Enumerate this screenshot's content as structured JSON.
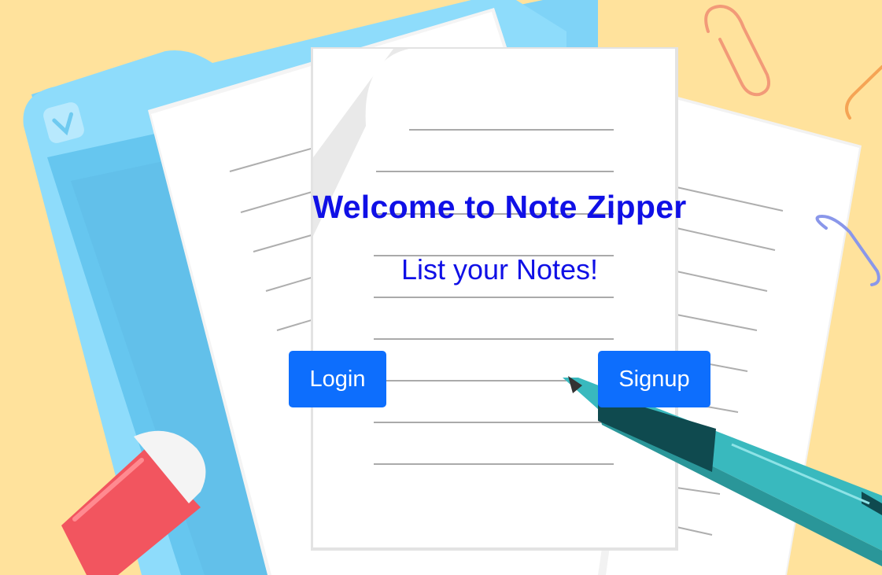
{
  "hero": {
    "title": "Welcome to Note Zipper",
    "subtitle": "List your Notes!"
  },
  "actions": {
    "login_label": "Login",
    "signup_label": "Signup"
  },
  "colors": {
    "background": "#ffe29c",
    "title_text": "#1010e6",
    "button_bg": "#0d6efd",
    "button_text": "#ffffff"
  }
}
